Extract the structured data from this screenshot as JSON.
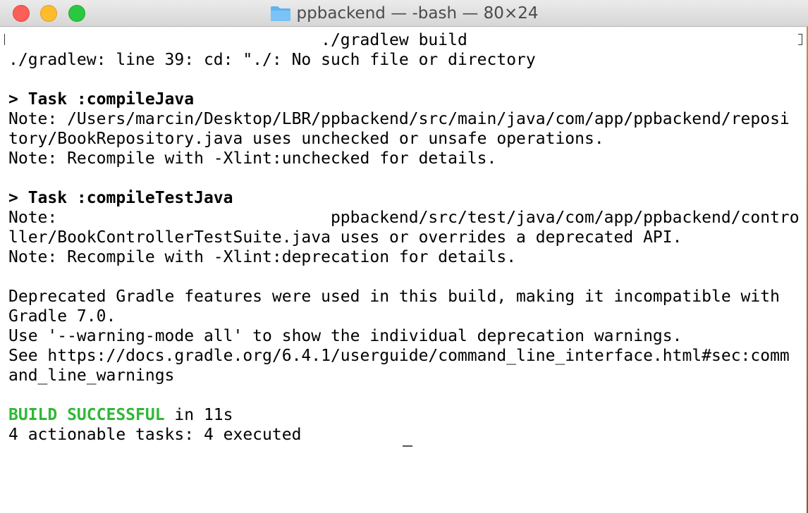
{
  "window": {
    "title": "ppbackend — -bash — 80×24",
    "folder_icon": "folder-icon"
  },
  "terminal": {
    "lines": [
      {
        "text": "                                ./gradlew build"
      },
      {
        "text": "./gradlew: line 39: cd: \"./: No such file or directory"
      },
      {
        "text": ""
      },
      {
        "text": "> Task :compileJava",
        "style": "bold"
      },
      {
        "text": "Note: /Users/marcin/Desktop/LBR/ppbackend/src/main/java/com/app/ppbackend/reposi"
      },
      {
        "text": "tory/BookRepository.java uses unchecked or unsafe operations."
      },
      {
        "text": "Note: Recompile with -Xlint:unchecked for details."
      },
      {
        "text": ""
      },
      {
        "text": "> Task :compileTestJava",
        "style": "bold"
      },
      {
        "text": "Note:                            ppbackend/src/test/java/com/app/ppbackend/contro"
      },
      {
        "text": "ller/BookControllerTestSuite.java uses or overrides a deprecated API."
      },
      {
        "text": "Note: Recompile with -Xlint:deprecation for details."
      },
      {
        "text": ""
      },
      {
        "text": "Deprecated Gradle features were used in this build, making it incompatible with"
      },
      {
        "text": "Gradle 7.0."
      },
      {
        "text": "Use '--warning-mode all' to show the individual deprecation warnings."
      },
      {
        "text": "See https://docs.gradle.org/6.4.1/userguide/command_line_interface.html#sec:comm"
      },
      {
        "text": "and_line_warnings"
      },
      {
        "text": ""
      },
      {
        "text": "BUILD SUCCESSFUL",
        "style": "green",
        "rest": " in 11s"
      },
      {
        "text": "4 actionable tasks: 4 executed"
      }
    ]
  },
  "colors": {
    "success": "#2fb835",
    "close": "#fc5f57",
    "minimize": "#fdbc2e",
    "zoom": "#29c840"
  }
}
